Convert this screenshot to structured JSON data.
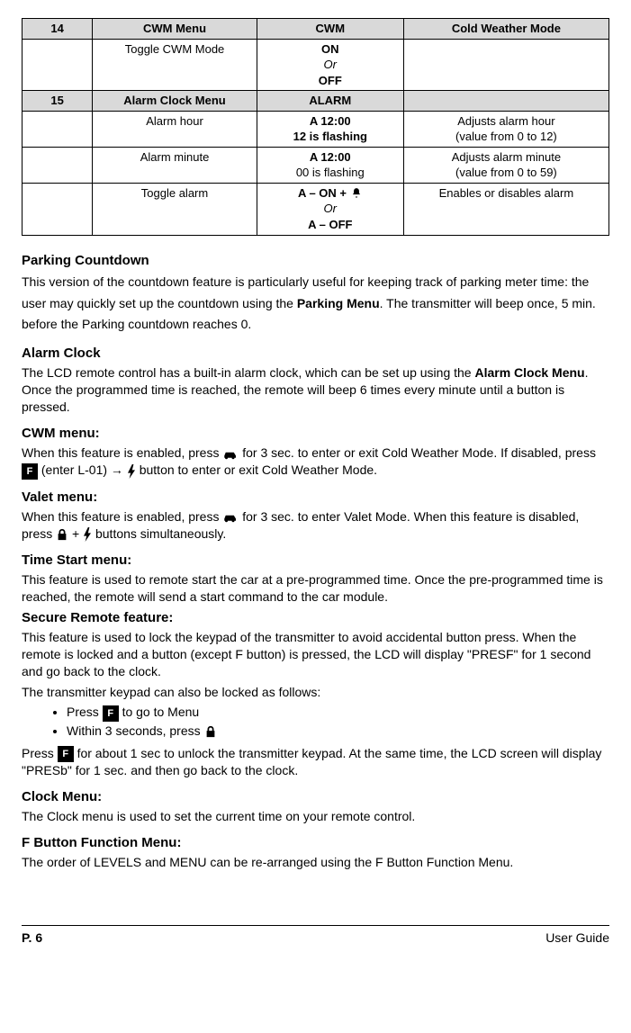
{
  "table": {
    "r1": {
      "c1": "14",
      "c2": "CWM Menu",
      "c3": "CWM",
      "c4": "Cold Weather Mode"
    },
    "r2": {
      "c1": "",
      "c2": "Toggle CWM Mode",
      "c3a": "ON",
      "c3b": "Or",
      "c3c": "OFF",
      "c4": ""
    },
    "r3": {
      "c1": "15",
      "c2": "Alarm Clock Menu",
      "c3": "ALARM",
      "c4": ""
    },
    "r4": {
      "c1": "",
      "c2": "Alarm hour",
      "c3a": "A 12:00",
      "c3b": "12 is flashing",
      "c4a": "Adjusts alarm hour",
      "c4b": "(value from 0 to 12)"
    },
    "r5": {
      "c1": "",
      "c2": "Alarm minute",
      "c3a": "A 12:00",
      "c3b": "00 is flashing",
      "c4a": "Adjusts alarm minute",
      "c4b": "(value from 0 to 59)"
    },
    "r6": {
      "c1": "",
      "c2": "Toggle alarm",
      "c3a": "A – ON + ",
      "c3b": "Or",
      "c3c": "A – OFF",
      "c4": "Enables or disables alarm"
    }
  },
  "parking": {
    "h": "Parking Countdown",
    "p": "This version of the countdown feature is particularly useful for keeping track of parking meter time: the user may quickly set up the countdown using the ",
    "menu": "Parking Menu",
    "p2": ". The transmitter will beep once, 5 min. before the Parking countdown reaches 0."
  },
  "alarm": {
    "h": "Alarm Clock",
    "p1": "The LCD remote control has a built-in alarm clock, which can be set up using the ",
    "menu": "Alarm Clock Menu",
    "p2": ". Once the programmed time is reached, the remote will beep 6 times every minute until a button is pressed."
  },
  "cwm": {
    "h": "CWM menu:",
    "p1a": "When this feature is enabled, press ",
    "p1b": " for 3 sec. to enter or exit Cold Weather Mode. If disabled, press ",
    "p1c": " (enter L-01) → ",
    "p1d": " button  to enter or exit Cold Weather Mode."
  },
  "valet": {
    "h": "Valet menu:",
    "p1a": "When this feature is enabled, press ",
    "p1b": " for 3 sec. to enter Valet Mode. When this feature is disabled, press ",
    "p1c": "  + ",
    "p1d": " buttons simultaneously."
  },
  "timestart": {
    "h": "Time Start menu:",
    "p": "This feature is used to remote start the car at a pre-programmed time. Once the pre-programmed time is reached, the remote will send a start command to the car module."
  },
  "secure": {
    "h": "Secure Remote feature:",
    "p1": "This feature is used to lock the keypad of the transmitter to avoid accidental button press. When the remote is locked and a button (except F button) is pressed, the LCD will display \"PRESF\" for 1 second and go back to the clock.",
    "p2": "The transmitter keypad can also be locked as follows:",
    "b1a": "Press ",
    "b1b": " to go to Menu",
    "b2a": "Within 3 seconds, press ",
    "p3a": "Press ",
    "p3b": " for about 1 sec to unlock the transmitter keypad. At the same time, the LCD screen will display \"PRESb\" for 1 sec. and then go back to the clock."
  },
  "clockmenu": {
    "h": "Clock Menu:",
    "p": "The Clock menu is used to set the current time on your remote control."
  },
  "fbutton": {
    "h": "F Button Function Menu:",
    "p": "The order of LEVELS and MENU can be re-arranged using the F Button Function Menu."
  },
  "footer": {
    "left": "P. 6",
    "right": "User Guide"
  }
}
